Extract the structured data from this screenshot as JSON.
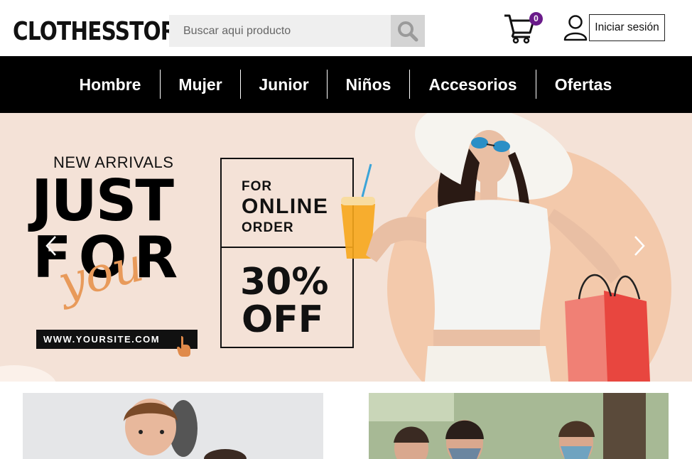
{
  "header": {
    "logo": "CLOTHESSTORE",
    "search_placeholder": "Buscar aqui producto",
    "cart_count": "0",
    "login_label": "Iniciar sesión"
  },
  "nav": {
    "items": [
      {
        "label": "Hombre"
      },
      {
        "label": "Mujer"
      },
      {
        "label": "Junior"
      },
      {
        "label": "Niños"
      },
      {
        "label": "Accesorios"
      },
      {
        "label": "Ofertas"
      }
    ]
  },
  "banner": {
    "new_arrivals": "NEW ARRIVALS",
    "just": "JUST",
    "for": "FOR",
    "you": "you",
    "site": "WWW.YOURSITE.COM",
    "for_label": "FOR",
    "online": "ONLINE",
    "order": "ORDER",
    "percent": "30%",
    "off": "OFF"
  },
  "icons": {
    "search": "search-icon",
    "cart": "cart-icon",
    "user": "user-icon",
    "prev": "chevron-left-icon",
    "next": "chevron-right-icon"
  },
  "colors": {
    "nav_bg": "#000000",
    "banner_bg": "#f4e2d7",
    "accent": "#e89a5a",
    "badge": "#6a1b8a"
  }
}
